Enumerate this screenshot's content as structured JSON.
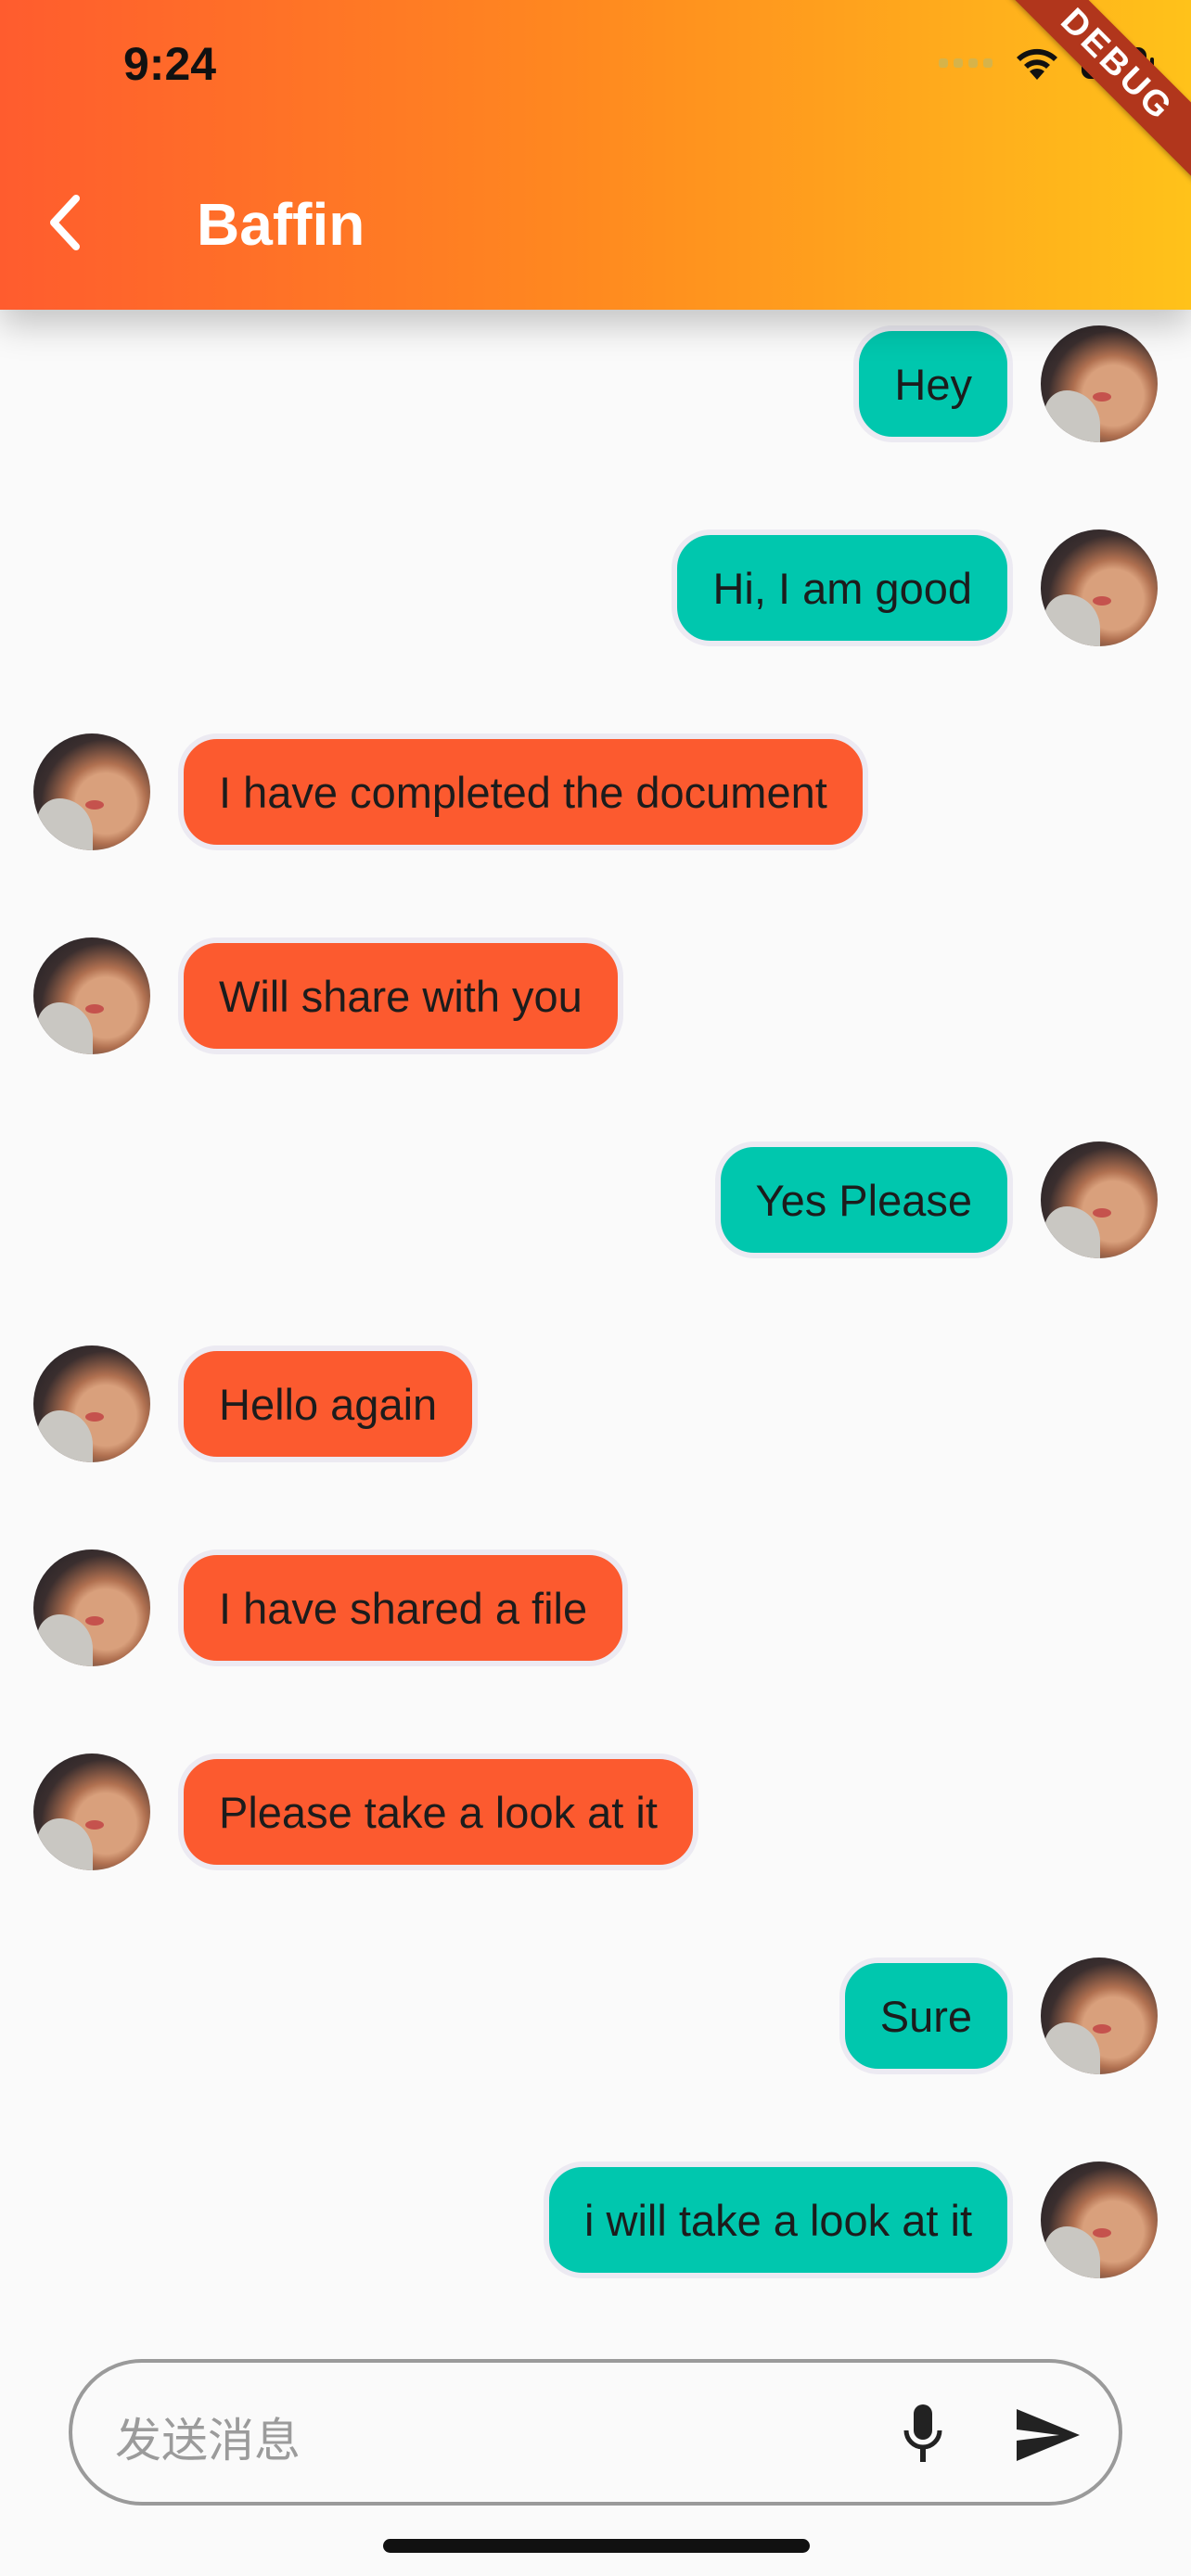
{
  "status": {
    "time": "9:24"
  },
  "header": {
    "title": "Baffin",
    "debug_label": "DEBUG"
  },
  "colors": {
    "outgoing": "#00c7ae",
    "incoming": "#fc5a2f",
    "header_start": "#ff5c2e",
    "header_end": "#ffc21a"
  },
  "messages": [
    {
      "text": "Hey",
      "side": "right"
    },
    {
      "text": "Hi, I am good",
      "side": "right"
    },
    {
      "text": "I have completed the document",
      "side": "left"
    },
    {
      "text": "Will share with you",
      "side": "left"
    },
    {
      "text": "Yes Please",
      "side": "right"
    },
    {
      "text": "Hello again",
      "side": "left"
    },
    {
      "text": "I have shared a file",
      "side": "left"
    },
    {
      "text": "Please take a look at it",
      "side": "left"
    },
    {
      "text": "Sure",
      "side": "right"
    },
    {
      "text": "i will take a look at it",
      "side": "right"
    }
  ],
  "composer": {
    "placeholder": "发送消息",
    "icons": [
      "microphone-icon",
      "send-icon"
    ]
  }
}
